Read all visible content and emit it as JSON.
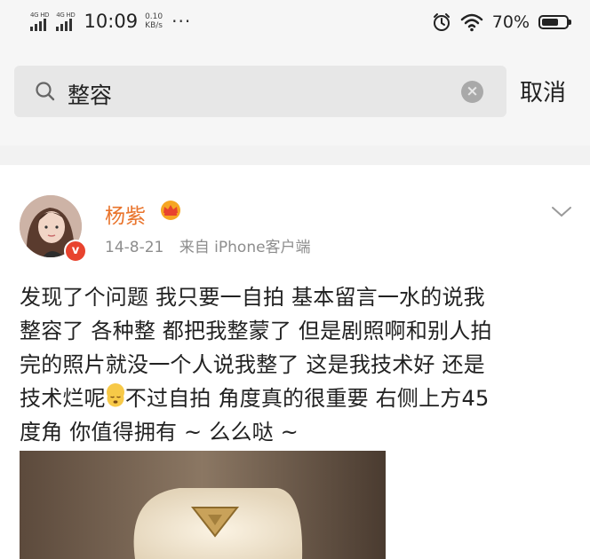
{
  "status_bar": {
    "network_1": "4G HD",
    "network_2": "4G HD",
    "time": "10:09",
    "speed_value": "0.10",
    "speed_unit": "KB/s",
    "more": "···",
    "battery_percent": "70%",
    "battery_level": 0.7
  },
  "search": {
    "query": "整容",
    "cancel_label": "取消",
    "clear_glyph": "×"
  },
  "post": {
    "author": "杨紫",
    "verified_mark": "v",
    "date": "14-8-21",
    "source": "来自 iPhone客户端",
    "text_before_emoji": "发现了个问题 我只要一自拍 基本留言一水的说我\n整容了 各种整 都把我整蒙了 但是剧照啊和别人拍\n完的照片就没一个人说我整了 这是我技术好 还是\n技术烂呢",
    "text_after_emoji": "不过自拍 角度真的很重要 右侧上方45\n度角 你值得拥有 ~ 么么哒 ~"
  },
  "colors": {
    "author": "#e9742c",
    "verified": "#e8432e",
    "meta": "#8d8d8d",
    "search_bg": "#e7e7e7"
  }
}
